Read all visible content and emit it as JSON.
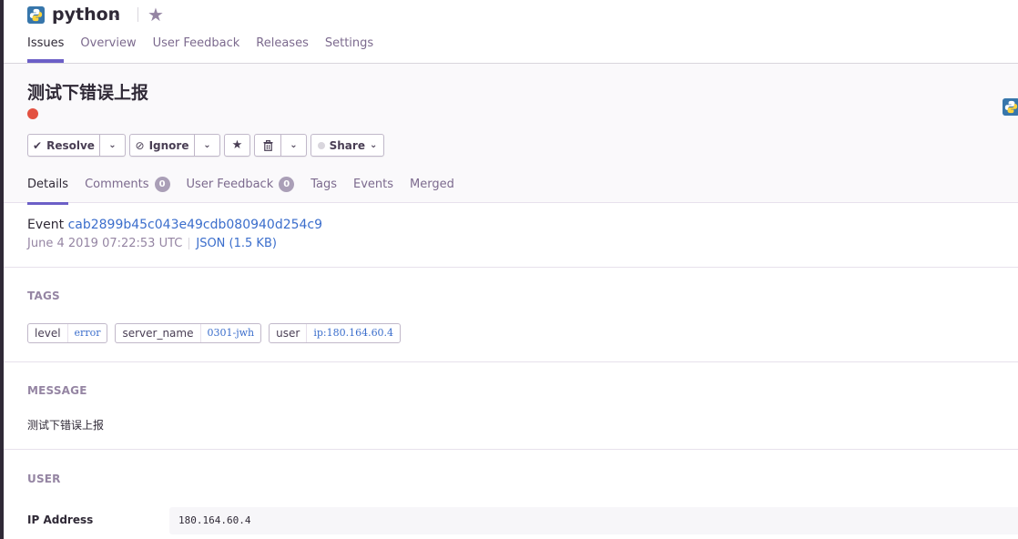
{
  "project": {
    "name": "python",
    "nav": [
      {
        "label": "Issues"
      },
      {
        "label": "Overview"
      },
      {
        "label": "User Feedback"
      },
      {
        "label": "Releases"
      },
      {
        "label": "Settings"
      }
    ]
  },
  "issue": {
    "title": "测试下错误上报",
    "level_color": "#e35141"
  },
  "actions": {
    "resolve_label": "Resolve",
    "ignore_label": "Ignore",
    "share_label": "Share"
  },
  "tabs": [
    {
      "label": "Details"
    },
    {
      "label": "Comments",
      "count": "0"
    },
    {
      "label": "User Feedback",
      "count": "0"
    },
    {
      "label": "Tags"
    },
    {
      "label": "Events"
    },
    {
      "label": "Merged"
    }
  ],
  "event": {
    "prefix": "Event",
    "id": "cab2899b45c043e49cdb080940d254c9",
    "timestamp": "June 4 2019 07:22:53 UTC",
    "json_link": "JSON (1.5 KB)"
  },
  "tags_section": {
    "title": "TAGS",
    "tags": [
      {
        "key": "level",
        "value": "error"
      },
      {
        "key": "server_name",
        "value": "0301-jwh"
      },
      {
        "key": "user",
        "value": "ip:180.164.60.4"
      }
    ]
  },
  "message_section": {
    "title": "MESSAGE",
    "text": "测试下错误上报"
  },
  "user_section": {
    "title": "USER",
    "rows": [
      {
        "key": "IP Address",
        "value": "180.164.60.4"
      }
    ]
  },
  "colors": {
    "accent": "#6c5fc7",
    "link": "#3b6ecc",
    "error": "#e35141"
  }
}
